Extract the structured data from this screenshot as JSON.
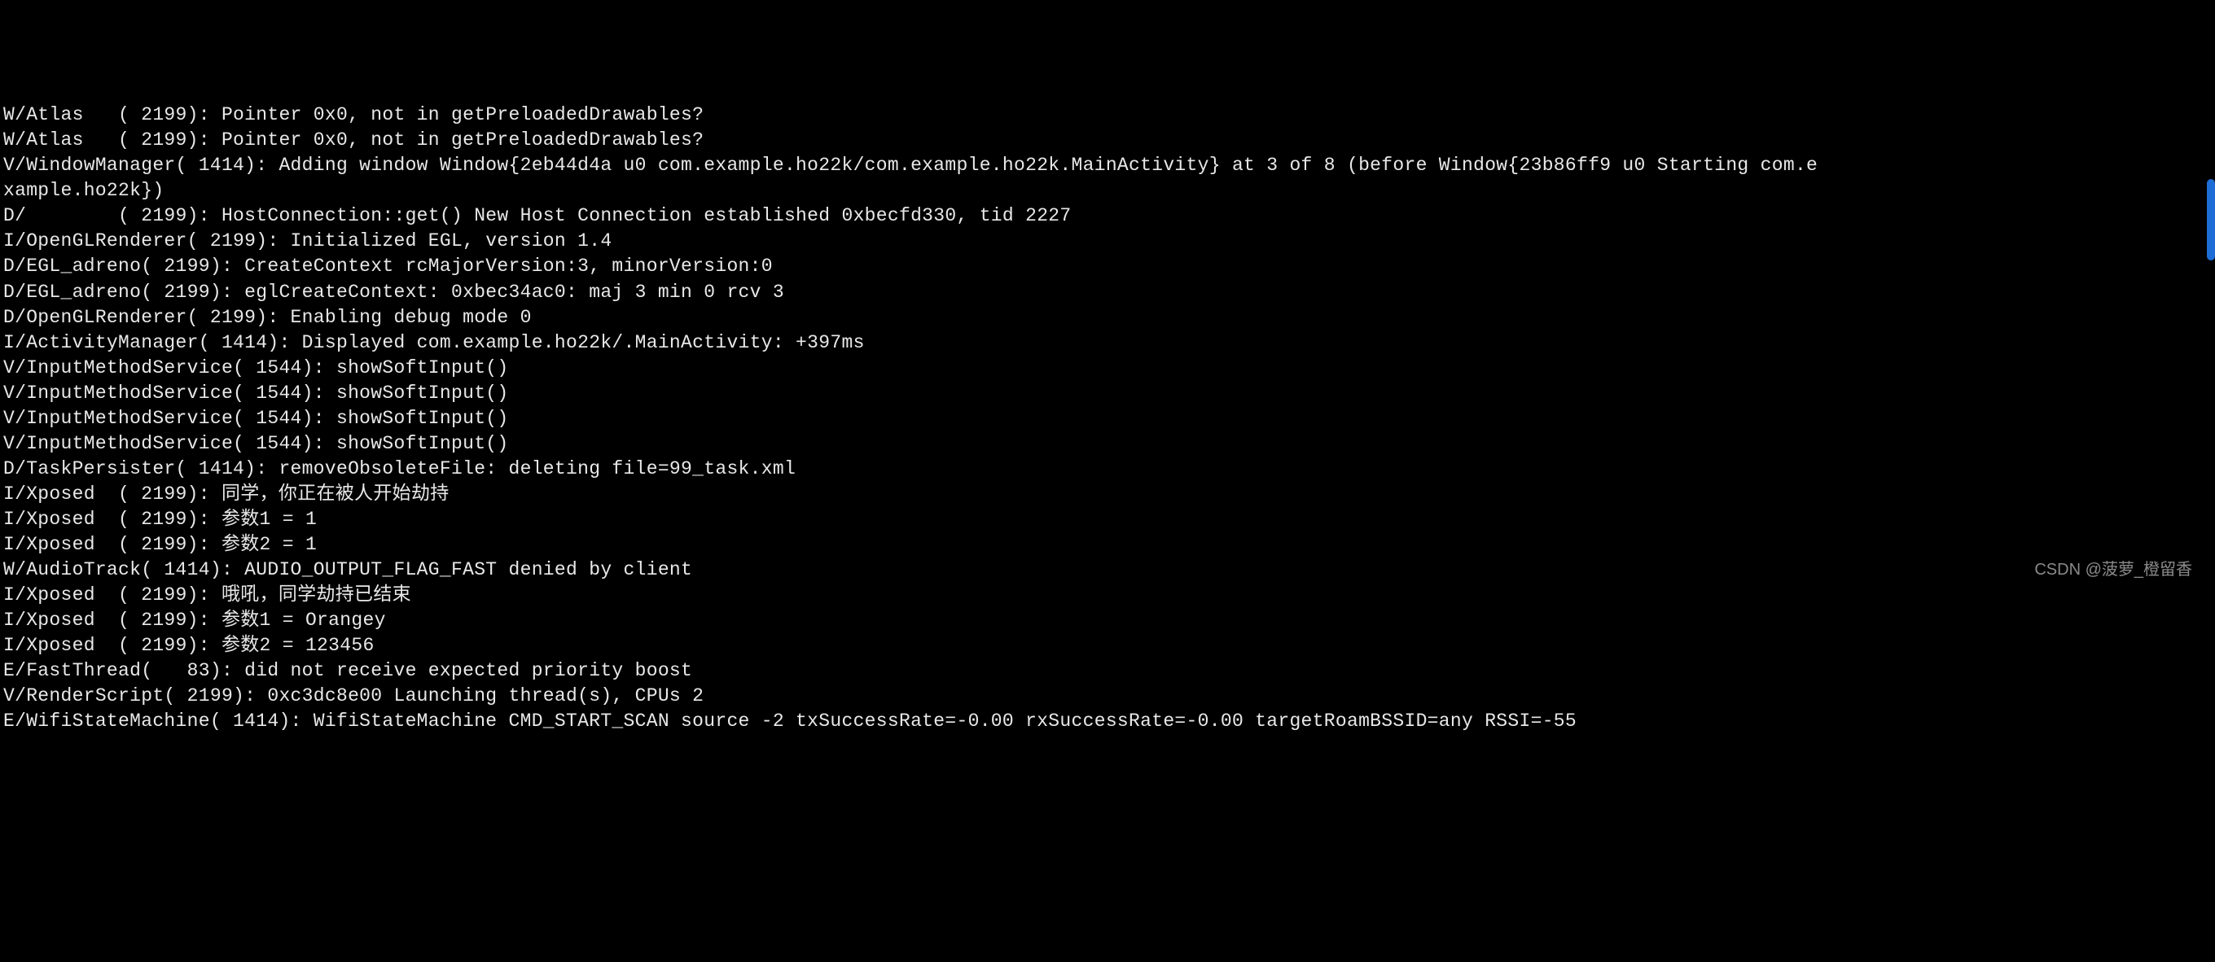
{
  "log": {
    "lines": [
      "W/Atlas   ( 2199): Pointer 0x0, not in getPreloadedDrawables?",
      "W/Atlas   ( 2199): Pointer 0x0, not in getPreloadedDrawables?",
      "V/WindowManager( 1414): Adding window Window{2eb44d4a u0 com.example.ho22k/com.example.ho22k.MainActivity} at 3 of 8 (before Window{23b86ff9 u0 Starting com.e",
      "xample.ho22k})",
      "D/        ( 2199): HostConnection::get() New Host Connection established 0xbecfd330, tid 2227",
      "I/OpenGLRenderer( 2199): Initialized EGL, version 1.4",
      "D/EGL_adreno( 2199): CreateContext rcMajorVersion:3, minorVersion:0",
      "D/EGL_adreno( 2199): eglCreateContext: 0xbec34ac0: maj 3 min 0 rcv 3",
      "D/OpenGLRenderer( 2199): Enabling debug mode 0",
      "I/ActivityManager( 1414): Displayed com.example.ho22k/.MainActivity: +397ms",
      "V/InputMethodService( 1544): showSoftInput()",
      "V/InputMethodService( 1544): showSoftInput()",
      "V/InputMethodService( 1544): showSoftInput()",
      "V/InputMethodService( 1544): showSoftInput()",
      "D/TaskPersister( 1414): removeObsoleteFile: deleting file=99_task.xml",
      "I/Xposed  ( 2199): 同学，你正在被人开始劫持",
      "I/Xposed  ( 2199): 参数1 = 1",
      "I/Xposed  ( 2199): 参数2 = 1",
      "W/AudioTrack( 1414): AUDIO_OUTPUT_FLAG_FAST denied by client",
      "I/Xposed  ( 2199): 哦吼，同学劫持已结束",
      "I/Xposed  ( 2199): 参数1 = Orangey",
      "I/Xposed  ( 2199): 参数2 = 123456",
      "E/FastThread(   83): did not receive expected priority boost",
      "V/RenderScript( 2199): 0xc3dc8e00 Launching thread(s), CPUs 2",
      "E/WifiStateMachine( 1414): WifiStateMachine CMD_START_SCAN source -2 txSuccessRate=-0.00 rxSuccessRate=-0.00 targetRoamBSSID=any RSSI=-55"
    ]
  },
  "watermark": "CSDN @菠萝_橙留香"
}
